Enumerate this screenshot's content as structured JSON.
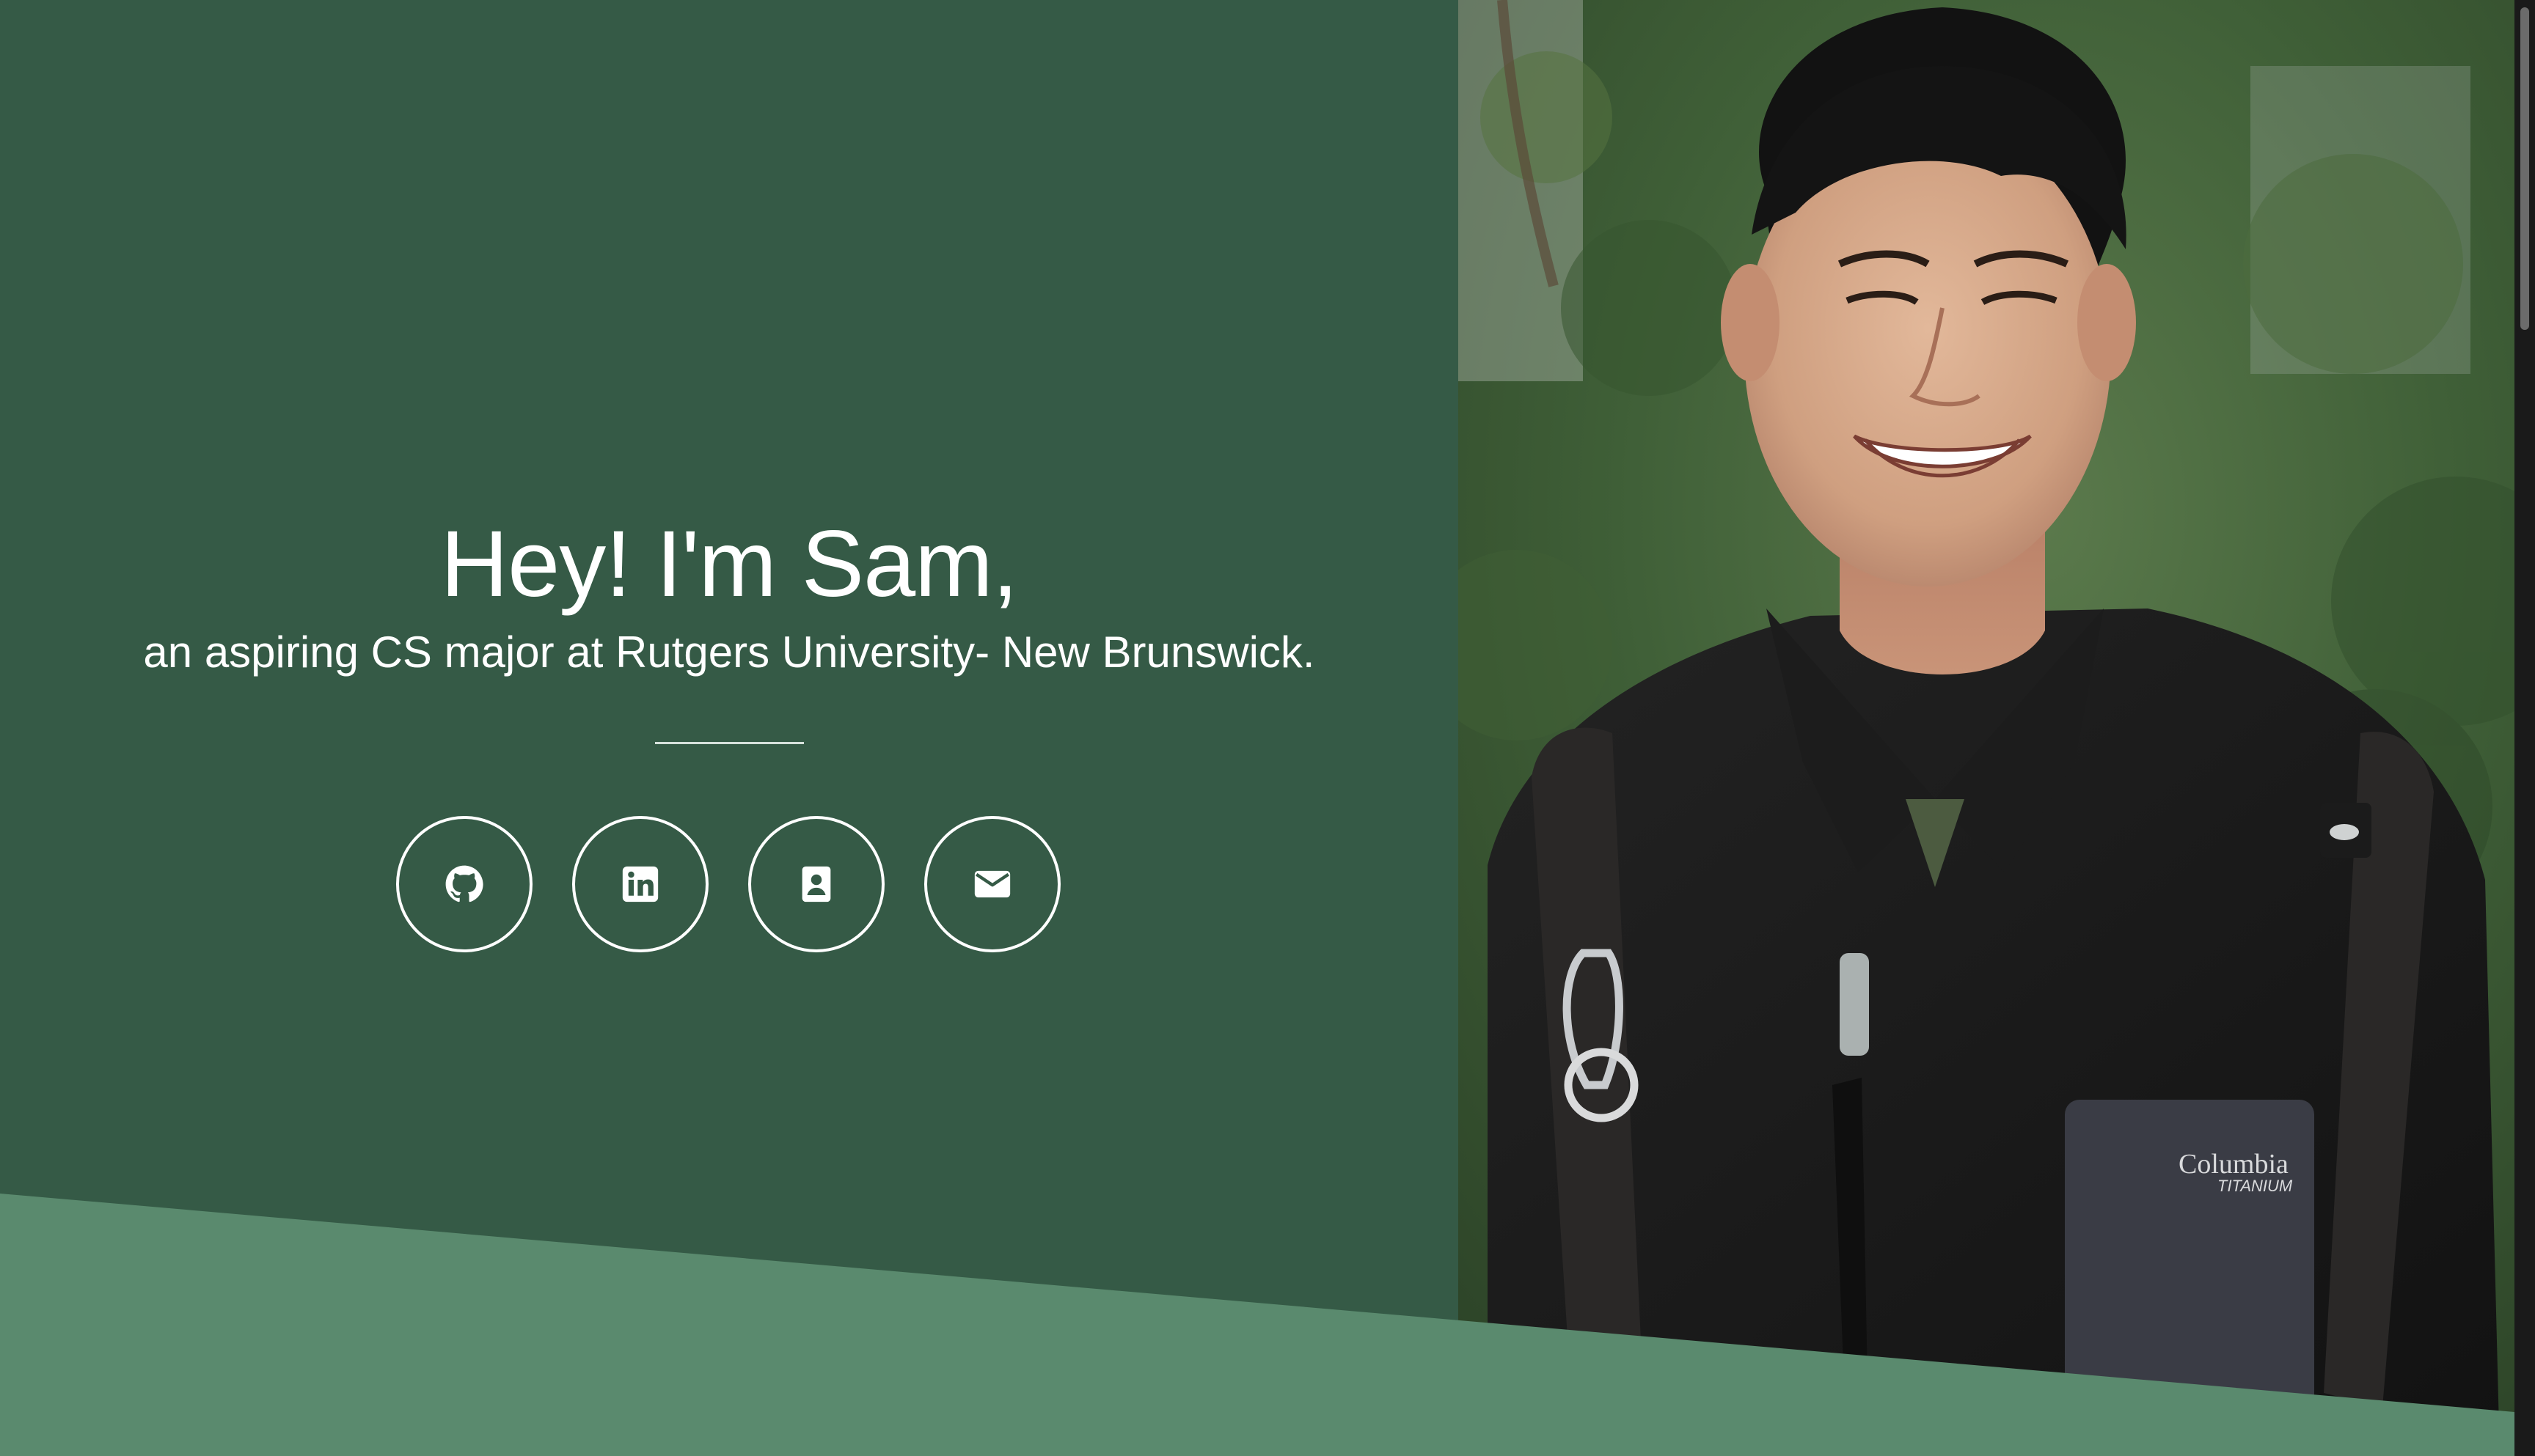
{
  "hero": {
    "headline": "Hey! I'm Sam,",
    "subline": "an aspiring CS major at Rutgers University- New Brunswick."
  },
  "socials": [
    {
      "icon": "github-icon"
    },
    {
      "icon": "linkedin-icon"
    },
    {
      "icon": "contact-card-icon"
    },
    {
      "icon": "mail-icon"
    }
  ],
  "colors": {
    "primary_green": "#355a46",
    "accent_green": "#5a8a6e",
    "text": "#ffffff"
  },
  "photo": {
    "brand_text": "Columbia",
    "brand_subtext": "TITANIUM"
  }
}
